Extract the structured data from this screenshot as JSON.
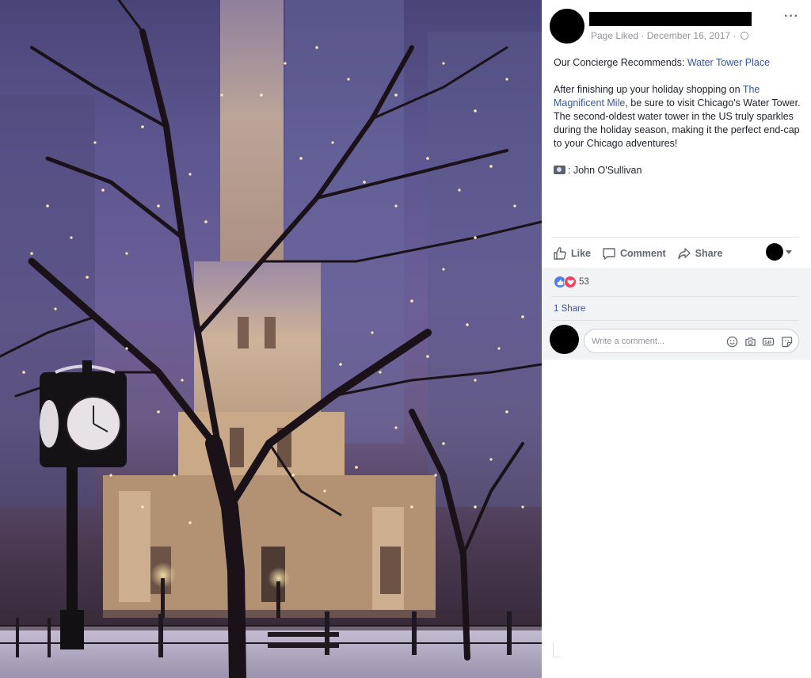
{
  "photo": {
    "alt_subject": "water-tower-night-photo"
  },
  "post": {
    "meta": "Page Liked · December 16, 2017 ·",
    "more_label": "···",
    "line1_prefix": "Our Concierge Recommends: ",
    "line1_link": "Water Tower Place",
    "para2_a": "After finishing up your holiday shopping on ",
    "para2_link": "The Magnificent Mile",
    "para2_b": ", be sure to visit Chicago's Water Tower. The second-oldest water tower in the US truly sparkles during the holiday season, making it the perfect end-cap to your Chicago adventures!",
    "credit": ": John O'Sullivan"
  },
  "actions": {
    "like": "Like",
    "comment": "Comment",
    "share": "Share"
  },
  "engagement": {
    "reaction_count": "53",
    "shares": "1 Share"
  },
  "comment": {
    "placeholder": "Write a comment..."
  },
  "colors": {
    "link": "#365899",
    "like_blue": "#4f7fe8",
    "love_red": "#f0405c",
    "muted": "#90949c"
  },
  "icons": [
    "thumb-up-icon",
    "comment-bubble-icon",
    "share-arrow-icon",
    "emoji-icon",
    "camera-icon",
    "gif-icon",
    "sticker-icon",
    "globe-icon",
    "photo-credit-camera-icon"
  ]
}
